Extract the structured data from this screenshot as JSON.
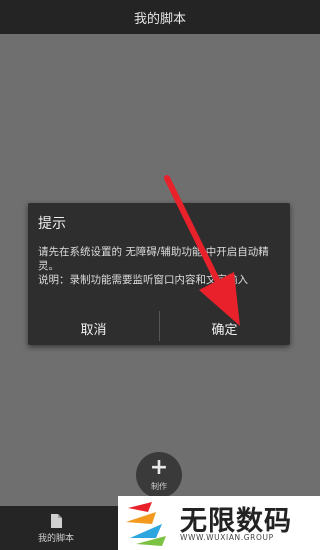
{
  "app": {
    "title": "我的脚本"
  },
  "dialog": {
    "title": "提示",
    "line1": "请先在系统设置的 无障碍/辅助功能 中开启自动精灵。",
    "line2": "说明：录制功能需要监听窗口内容和文字输入",
    "cancel_label": "取消",
    "ok_label": "确定"
  },
  "fab": {
    "label": "制作",
    "icon": "plus-icon"
  },
  "bottom_nav": {
    "scripts_label": "我的脚本",
    "scripts_icon": "document-icon"
  },
  "watermark": {
    "name": "无限数码",
    "url": "WWW.WUXIAN.GROUP"
  },
  "colors": {
    "arrow": "#e8212b",
    "dialog_bg": "#2e2e2e",
    "topbar_bg": "#242424",
    "overlay_bg": "#6f6f6f"
  }
}
